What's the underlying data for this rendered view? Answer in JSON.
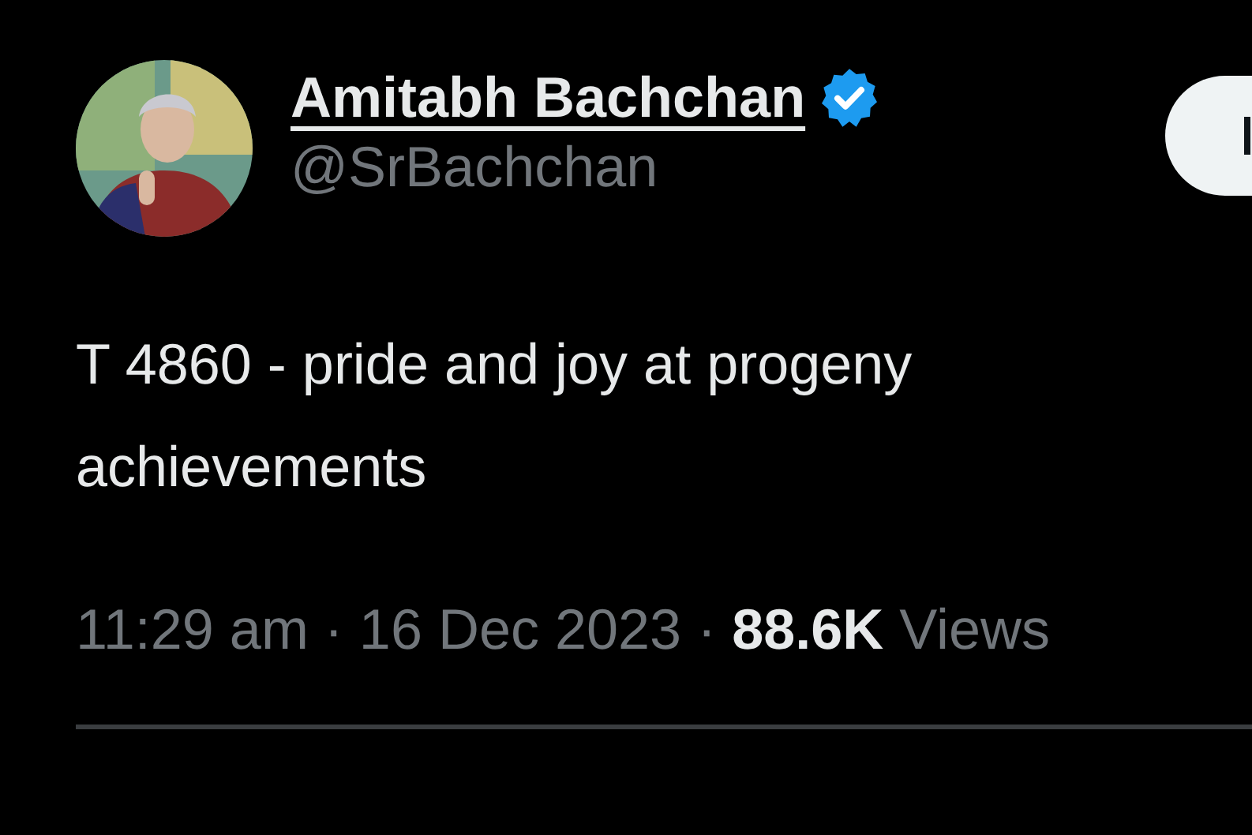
{
  "author": {
    "name": "Amitabh Bachchan",
    "verified": true,
    "handle": "@SrBachchan"
  },
  "tweet": {
    "text": "T 4860 - pride and joy at progeny achievements",
    "meta": "11:29 am · 16 Dec 2023 · **88.6K** Views"
  }
}
